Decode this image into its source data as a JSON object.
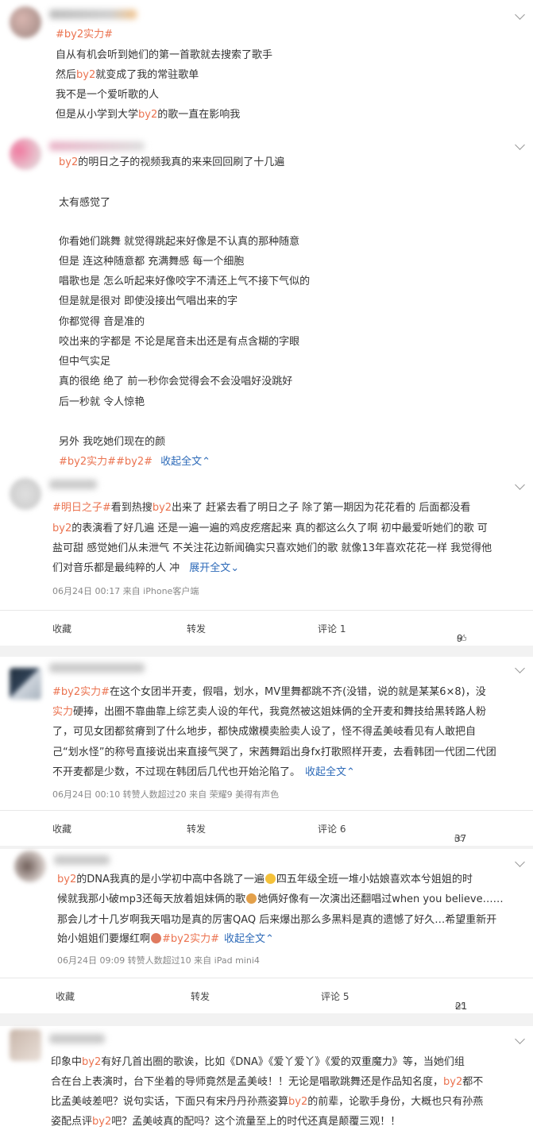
{
  "post1": {
    "lines": [
      "自从有机会听到她们的第一首歌就去搜索了歌手",
      "然后by2就变成了我的常驻歌单",
      "我不是一个爱听歌的人",
      "但是从小学到大学by2的歌一直在影响我"
    ],
    "tag": "#by2实力#"
  },
  "post2": {
    "lines": [
      "by2的明日之子的视频我真的来来回回刷了十几遍",
      "太有感觉了",
      "你看她们跳舞 就觉得跳起来好像是不认真的那种随意",
      "但是 连这种随意都 充满舞感 每一个细胞",
      "唱歌也是 怎么听起来好像咬字不清还上气不接下气似的",
      "但是就是很对 即使没接出气唱出来的字",
      "你都觉得 音是准的",
      "咬出来的字都是 不论是尾音未出还是有点含糊的字眼",
      "但中气实足",
      "真的很绝 绝了 前一秒你会觉得会不会没唱好没跳好",
      "后一秒就 令人惊艳",
      "另外 我吃她们现在的颜"
    ],
    "tags": "#by2实力##by2#",
    "collapse": "收起全文"
  },
  "post3": {
    "lines": [
      "#明日之子#看到热搜by2出来了 赶紧去看了明日之子 除了第一期因为花花看的 后面都没看",
      "by2的表演看了好几遍 还是一遍一遍的鸡皮疙瘩起来 真的都这么久了啊 初中最爱听她们的歌 可",
      "盐可甜 感觉她们从未泄气 不关注花边新闻确实只喜欢她们的歌 就像13年喜欢花花一样 我觉得他",
      "们对音乐都是最纯粹的人 冲"
    ],
    "expand": "展开全文",
    "meta": "06月24日 00:17  来自 iPhone客户端",
    "actions": {
      "fav": "收藏",
      "repost": "转发",
      "comment": "评论 1",
      "like": "9"
    }
  },
  "post4": {
    "lines": [
      "#by2实力#在这个女团半开麦，假唱，划水，MV里舞都跳不齐(没错，说的就是某某6×8)，没",
      "实力硬捧，出圈不靠曲靠上综艺卖人设的年代，我竟然被这姐妹俩的全开麦和舞技给黑转路人粉",
      "了，可见女团都贫瘠到了什么地步，都快成嫩模卖脸卖人设了，怪不得孟美岐看见有人敢把自",
      "己“划水怪”的称号直接说出来直接气哭了，宋茜舞蹈出身fx打歌照样开麦，去看韩团一代团二代团",
      "不开麦都是少数，不过现在韩团后几代也开始沦陷了。"
    ],
    "collapse": "收起全文",
    "meta": "06月24日 00:10  转赞人数超过20  来自 荣耀9 美得有声色",
    "actions": {
      "fav": "收藏",
      "repost": "转发",
      "comment": "评论 6",
      "like": "37"
    }
  },
  "post5": {
    "lines": [
      "by2的DNA我真的是小学初中高中各跳了一遍",
      "四五年级全班一堆小姑娘喜欢本兮姐姐的时",
      "候就我那小破mp3还每天放着姐妹俩的歌",
      "她俩好像有一次演出还翻唱过when you believe……",
      "那会儿才十几岁啊我天唱功是真的厉害QAQ 后来爆出那么多黑料是真的遗憾了好久…希望重新开",
      "始小姐姐们要爆红啊",
      "#by2实力#"
    ],
    "collapse": "收起全文",
    "meta": "06月24日 09:09  转赞人数超过10  来自 iPad mini4",
    "actions": {
      "fav": "收藏",
      "repost": "转发",
      "comment": "评论 5",
      "like": "21"
    }
  },
  "post6": {
    "lines": [
      "印象中by2有好几首出圈的歌诶，比如《DNA》《爱丫爱丫》《爱的双重魔力》等，当她们组",
      "合在台上表演时，台下坐着的导师竟然是孟美岐！！无论是唱歌跳舞还是作品知名度，by2都不",
      "比孟美岐差吧？说句实话，下面只有宋丹丹孙燕姿算by2的前辈，论歌手身份，大概也只有孙燕",
      "姿配点评by2吧？孟美岐真的配吗？这个流量至上的时代还真是颠覆三观！！"
    ]
  },
  "colors": {
    "accent": "#eb7350",
    "link": "#2d6ab8",
    "bg_gap": "#f2f2f2"
  }
}
